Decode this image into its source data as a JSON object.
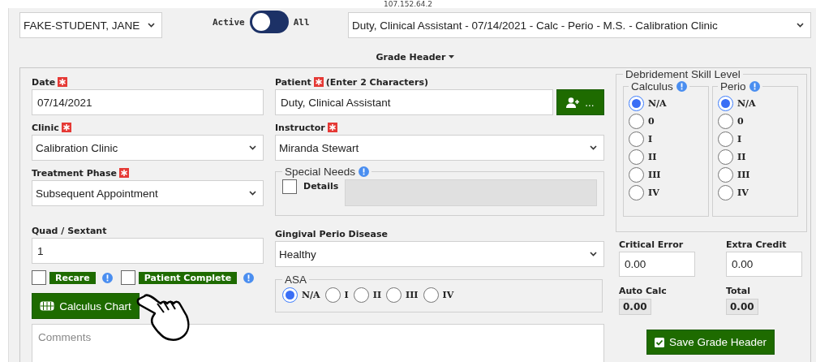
{
  "address": "107.152.64.2",
  "student_select": {
    "value": "FAKE-STUDENT, JANE"
  },
  "filter_toggle": {
    "left_label": "Active",
    "right_label": "All",
    "on": false
  },
  "appointment_select": {
    "value": "Duty, Clinical Assistant - 07/14/2021 - Calc - Perio - M.S. - Calibration Clinic"
  },
  "section_toggle": {
    "label": "Grade Header"
  },
  "date": {
    "label": "Date",
    "required": true,
    "value": "07/14/2021"
  },
  "patient": {
    "label": "Patient",
    "required": true,
    "hint": "(Enter 2 Characters)",
    "value": "Duty, Clinical Assistant",
    "button_text": "..."
  },
  "clinic": {
    "label": "Clinic",
    "required": true,
    "value": "Calibration Clinic"
  },
  "instructor": {
    "label": "Instructor",
    "required": true,
    "value": "Miranda Stewart"
  },
  "treatment_phase": {
    "label": "Treatment Phase",
    "required": true,
    "value": "Subsequent Appointment"
  },
  "special_needs": {
    "legend": "Special Needs",
    "checked": false,
    "details_label": "Details",
    "details_disabled": true
  },
  "quad_sextant": {
    "label": "Quad / Sextant",
    "value": "1"
  },
  "gingival_perio_disease": {
    "label": "Gingival Perio Disease",
    "value": "Healthy"
  },
  "flags": [
    {
      "label": "Recare",
      "checked": false
    },
    {
      "label": "Patient Complete",
      "checked": false
    }
  ],
  "asa": {
    "legend": "ASA",
    "options": [
      {
        "label": "N/A",
        "selected": true
      },
      {
        "label": "I",
        "selected": false
      },
      {
        "label": "II",
        "selected": false
      },
      {
        "label": "III",
        "selected": false
      },
      {
        "label": "IV",
        "selected": false
      }
    ]
  },
  "calculus_chart_button": "Calculus Chart",
  "comments": {
    "placeholder": "Comments"
  },
  "debridement": {
    "legend": "Debridement Skill Level",
    "groups": [
      {
        "legend": "Calculus",
        "options": [
          {
            "label": "N/A",
            "selected": true
          },
          {
            "label": "0",
            "selected": false
          },
          {
            "label": "I",
            "selected": false
          },
          {
            "label": "II",
            "selected": false
          },
          {
            "label": "III",
            "selected": false
          },
          {
            "label": "IV",
            "selected": false
          }
        ]
      },
      {
        "legend": "Perio",
        "options": [
          {
            "label": "N/A",
            "selected": true
          },
          {
            "label": "0",
            "selected": false
          },
          {
            "label": "I",
            "selected": false
          },
          {
            "label": "II",
            "selected": false
          },
          {
            "label": "III",
            "selected": false
          },
          {
            "label": "IV",
            "selected": false
          }
        ]
      }
    ]
  },
  "scores": [
    {
      "label": "Critical Error",
      "value": "0.00",
      "kind": "input"
    },
    {
      "label": "Extra Credit",
      "value": "0.00",
      "kind": "input"
    },
    {
      "label": "Auto Calc",
      "value": "0.00",
      "kind": "readout"
    },
    {
      "label": "Total",
      "value": "0.00",
      "kind": "readout"
    }
  ],
  "save_button": "Save Grade Header"
}
